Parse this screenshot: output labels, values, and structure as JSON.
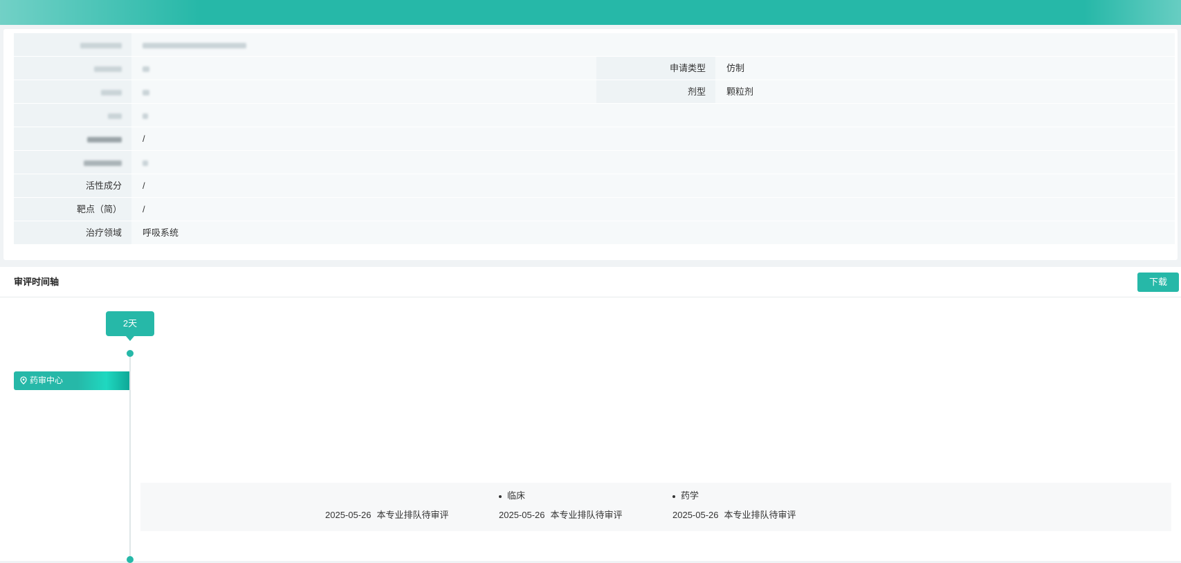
{
  "info": {
    "rows": [
      {
        "label": "",
        "value": ""
      },
      {
        "label": "",
        "value": "",
        "right_label": "申请类型",
        "right_value": "仿制"
      },
      {
        "label": "",
        "value": "",
        "right_label": "剂型",
        "right_value": "颗粒剂"
      },
      {
        "label": "",
        "value": ""
      },
      {
        "label": "",
        "value": "/"
      },
      {
        "label": "",
        "value": ""
      },
      {
        "label": "活性成分",
        "value": "/"
      },
      {
        "label": "靶点（简）",
        "value": "/"
      },
      {
        "label": "治疗领域",
        "value": "呼吸系统"
      }
    ]
  },
  "timeline": {
    "title": "审评时间轴",
    "download_label": "下载",
    "duration_tag": "2天",
    "node_label": "药审中心",
    "status": [
      {
        "head": "",
        "date": "2025-05-26",
        "text": "本专业排队待审评"
      },
      {
        "head": "临床",
        "date": "2025-05-26",
        "text": "本专业排队待审评"
      },
      {
        "head": "药学",
        "date": "2025-05-26",
        "text": "本专业排队待审评"
      }
    ]
  },
  "colors": {
    "accent": "#26b8a8"
  }
}
